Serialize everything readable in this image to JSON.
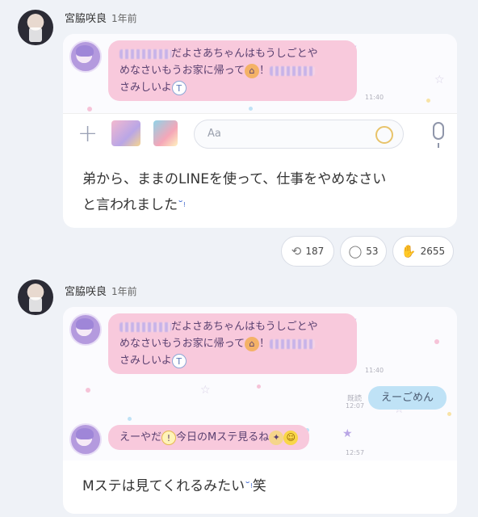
{
  "posts": [
    {
      "author": "宮脇咲良",
      "time": "1年前",
      "chat": {
        "message_line1": "だよさあちゃんはもうしごとや",
        "message_line2": "めなさいもうお家に帰って",
        "message_mark": "！",
        "message_line3": "さみしいよ",
        "message_time": "11:40",
        "input_placeholder": "Aa"
      },
      "caption_line1": "弟から、ままのLINEを使って、仕事をやめなさい",
      "caption_line2": "と言われました",
      "stats": {
        "reposts": "187",
        "comments": "53",
        "likes": "2655"
      }
    },
    {
      "author": "宮脇咲良",
      "time": "1年前",
      "chat": {
        "message1_line1": "だよさあちゃんはもうしごとや",
        "message1_line2": "めなさいもうお家に帰って",
        "message1_mark": "！",
        "message1_line3": "さみしいよ",
        "message1_time": "11:40",
        "read_label": "既読",
        "reply_time": "12:07",
        "reply": "えーごめん",
        "message2_prefix": "えーやだ",
        "message2_text": "今日のMステ見るね",
        "message2_time": "12:57"
      },
      "caption_line1": "Mステは見てくれるみたい",
      "caption_suffix": "笑"
    }
  ],
  "colors": {
    "bubble_left": "#f8c9dc",
    "bubble_right": "#bfe2f6",
    "page_bg": "#eff2f7"
  },
  "icons": [
    "repost-icon",
    "comment-icon",
    "clap-icon",
    "plus-icon",
    "mic-icon",
    "emoji-icon",
    "house-icon",
    "crying-face-icon",
    "party-popper-icon",
    "smile-icon"
  ]
}
